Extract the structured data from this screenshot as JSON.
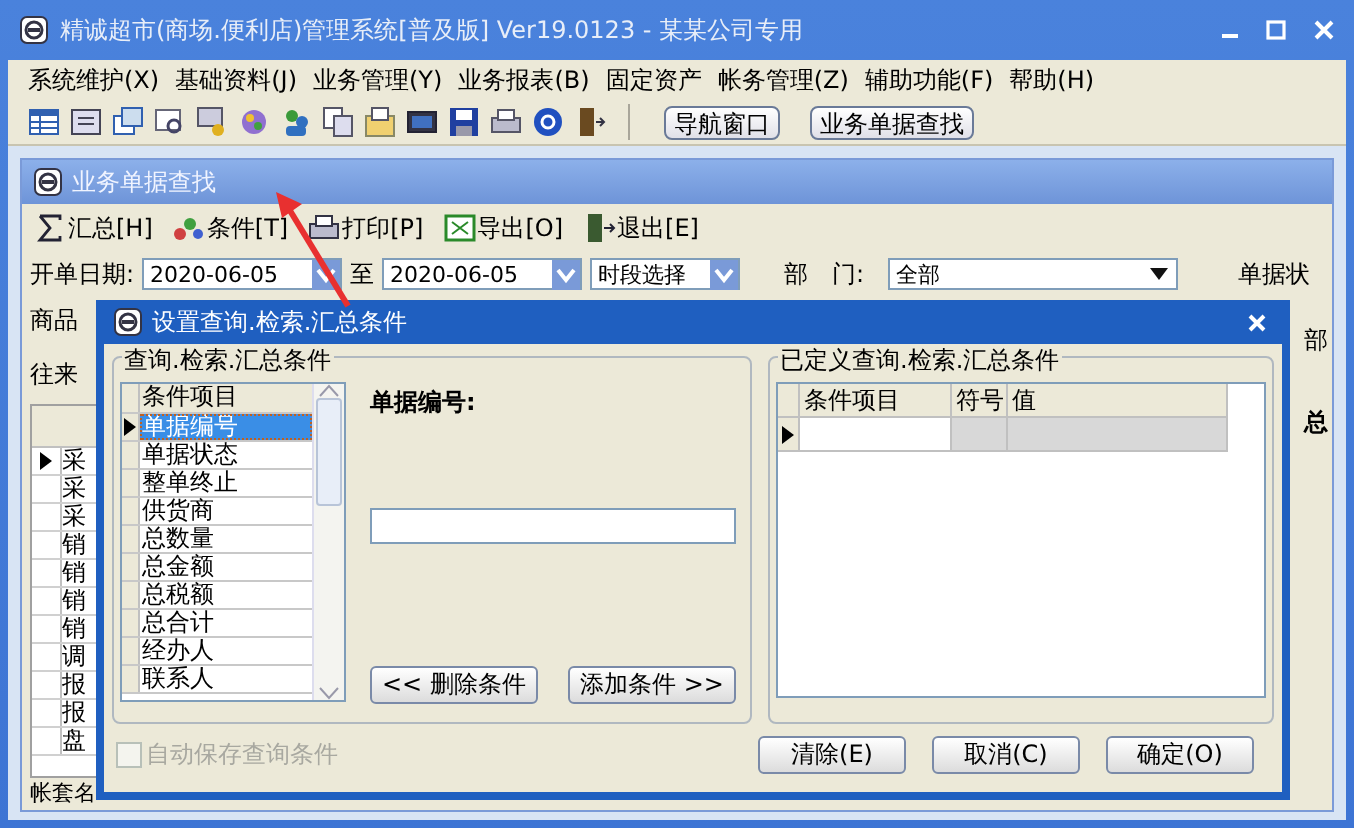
{
  "window": {
    "title": "精诚超市(商场.便利店)管理系统[普及版] Ver19.0123  -  某某公司专用"
  },
  "menu": [
    "系统维护(X)",
    "基础资料(J)",
    "业务管理(Y)",
    "业务报表(B)",
    "固定资产",
    "帐务管理(Z)",
    "辅助功能(F)",
    "帮助(H)"
  ],
  "toolbar": {
    "buttons": [
      "导航窗口",
      "业务单据查找"
    ]
  },
  "child_window": {
    "title": "业务单据查找",
    "toolbar": [
      {
        "kind": "sum",
        "label": "汇总[H]"
      },
      {
        "kind": "filter",
        "label": "条件[T]"
      },
      {
        "kind": "print",
        "label": "打印[P]"
      },
      {
        "kind": "export",
        "label": "导出[O]"
      },
      {
        "kind": "exit",
        "label": "退出[E]"
      }
    ],
    "filters": {
      "date_label": "开单日期:",
      "date_from": "2020-06-05",
      "to_label": "至",
      "date_to": "2020-06-05",
      "period": "时段选择",
      "dept_label": "部　门:",
      "dept": "全部",
      "status_group": "单据状",
      "status_value": "部"
    },
    "labels": [
      "商品",
      "往来"
    ],
    "grid": {
      "column_header": "总",
      "rows": [
        {
          "text": "采",
          "selected": true
        },
        {
          "text": "采",
          "selected": false
        },
        {
          "text": "采",
          "selected": false
        },
        {
          "text": "销",
          "selected": false
        },
        {
          "text": "销",
          "selected": false
        },
        {
          "text": "销",
          "selected": false
        },
        {
          "text": "销",
          "selected": false
        },
        {
          "text": "调",
          "selected": false
        },
        {
          "text": "报",
          "selected": false
        },
        {
          "text": "报",
          "selected": false
        },
        {
          "text": "盘",
          "selected": false
        }
      ]
    },
    "status_bar": "帐套名"
  },
  "dialog": {
    "title": "设置查询.检索.汇总条件",
    "left_group": {
      "title": "查询.检索.汇总条件",
      "list_header": "条件项目",
      "items": [
        {
          "label": "单据编号",
          "selected": true
        },
        {
          "label": "单据状态",
          "selected": false
        },
        {
          "label": "整单终止",
          "selected": false
        },
        {
          "label": "供货商",
          "selected": false
        },
        {
          "label": "总数量",
          "selected": false
        },
        {
          "label": "总金额",
          "selected": false
        },
        {
          "label": "总税额",
          "selected": false
        },
        {
          "label": "总合计",
          "selected": false
        },
        {
          "label": "经办人",
          "selected": false
        },
        {
          "label": "联系人",
          "selected": false
        }
      ],
      "field_label": "单据编号:",
      "delete_button": "<< 删除条件",
      "add_button": "添加条件 >>"
    },
    "right_group": {
      "title": "已定义查询.检索.汇总条件",
      "columns": [
        "条件项目",
        "符号",
        "值"
      ]
    },
    "autosave": {
      "label": "自动保存查询条件",
      "checked": false,
      "disabled": true
    },
    "buttons": [
      "清除(E)",
      "取消(C)",
      "确定(O)"
    ]
  }
}
